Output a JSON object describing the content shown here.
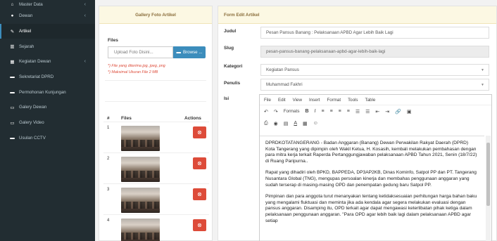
{
  "sidebar": {
    "items": [
      {
        "label": "Master Data",
        "icon": "dashboard-icon",
        "glyph": "⌂",
        "chevron": "‹"
      },
      {
        "label": "Dewan",
        "icon": "user-icon",
        "glyph": "●",
        "chevron": "‹"
      },
      {
        "label": "Artikel",
        "icon": "article-icon",
        "glyph": "✎",
        "chevron": ""
      },
      {
        "label": "Sejarah",
        "icon": "bank-icon",
        "glyph": "▥",
        "chevron": ""
      },
      {
        "label": "Kegiatan Dewan",
        "icon": "table-icon",
        "glyph": "▦",
        "chevron": "‹"
      },
      {
        "label": "Sekretariat DPRD",
        "icon": "folder-icon",
        "glyph": "▬",
        "chevron": ""
      },
      {
        "label": "Permohonan Kunjungan",
        "icon": "folder-icon",
        "glyph": "▬",
        "chevron": ""
      },
      {
        "label": "Galery Dewan",
        "icon": "laptop-icon",
        "glyph": "▭",
        "chevron": ""
      },
      {
        "label": "Galery Video",
        "icon": "laptop-icon",
        "glyph": "▭",
        "chevron": ""
      },
      {
        "label": "Usulan CCTV",
        "icon": "folder-icon",
        "glyph": "▬",
        "chevron": ""
      }
    ]
  },
  "gallery": {
    "title": "Gallery Foto Artikel",
    "files_label": "Files",
    "upload_placeholder": "Upload Foto Disini...",
    "browse_label": "Browse ...",
    "note_1": "*) File yang diterima jpg, jpeg, png",
    "note_2": "*) Maksimal Ukuran File 2 MB",
    "headers": {
      "num": "#",
      "files": "Files",
      "actions": "Actions"
    },
    "rows": [
      {
        "num": "1"
      },
      {
        "num": "2"
      },
      {
        "num": "3"
      },
      {
        "num": "4"
      }
    ]
  },
  "form": {
    "title": "Form Edit Artikel",
    "judul_label": "Judul",
    "judul_value": "Pesan Pansus Banang : Pelaksanaan APBD Agar Lebih Baik Lagi",
    "slug_label": "Slug",
    "slug_value": "pesan-pansus-banang-pelaksanaan-apbd-agar-lebih-baik-lagi",
    "kategori_label": "Kategori",
    "kategori_value": "Kegiatan Pansus",
    "penulis_label": "Penulis",
    "penulis_value": "Muhammad Fakhri",
    "isi_label": "Isi"
  },
  "editor": {
    "menu": {
      "file": "File",
      "edit": "Edit",
      "view": "View",
      "insert": "Insert",
      "format": "Format",
      "tools": "Tools",
      "table": "Table"
    },
    "formats_label": "Formats",
    "paragraphs": [
      "DPRDKOTATANGERANG - Badan Anggaran (Banang) Dewan Perwakilan Rakyat Daerah (DPRD) Kota Tangerang yang dipimpin oleh Wakil Ketua, H. Kosasih, kembali melakukan pembahasan dengan para mitra kerja terkait Raperda Pertanggungjawaban pelaksanaan APBD Tahun 2021, Senin (18/7/22) di Ruang Paripurna..",
      "Rapat yang dihadiri oleh BPKD, BAPPEDA, DP3AP2KB, Dinas Kominfo, Satpol PP dan PT. Tangerang Nusantara Global (TNG), mengupas persoalan kinerja dan membahas penggunaan anggaran yang sudah terserap di masing-masing OPD dan penempatan gedung baru Satpol PP.",
      "Pimpinan dan para anggota turut menanyakan tentang ketidaksesuaian perhitungan harga bahan baku yang mengalami fluktuasi dan meminta jika ada kendala agar segera melakukan evaluasi dengan pansus anggaran. Disamping itu, OPD terkait agar dapat mengawasi keterlibatan pihak ketiga dalam pelaksanaan penggunaan anggaran. \"Para OPD agar lebih baik lagi dalam pelaksanaan APBD agar setiap"
    ]
  }
}
